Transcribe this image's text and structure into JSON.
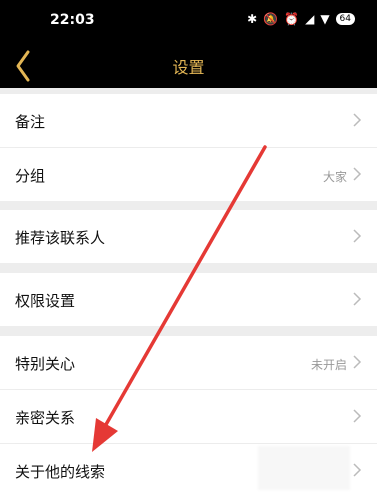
{
  "status_bar": {
    "time": "22:03",
    "battery": "64"
  },
  "header": {
    "title": "设置"
  },
  "rows": [
    {
      "label": "备注",
      "value": ""
    },
    {
      "label": "分组",
      "value": "大家"
    },
    {
      "label": "推荐该联系人",
      "value": ""
    },
    {
      "label": "权限设置",
      "value": ""
    },
    {
      "label": "特别关心",
      "value": "未开启"
    },
    {
      "label": "亲密关系",
      "value": ""
    },
    {
      "label": "关于他的线索",
      "value": ""
    }
  ],
  "colors": {
    "accent": "#e3b655",
    "annotation": "#e53935"
  }
}
